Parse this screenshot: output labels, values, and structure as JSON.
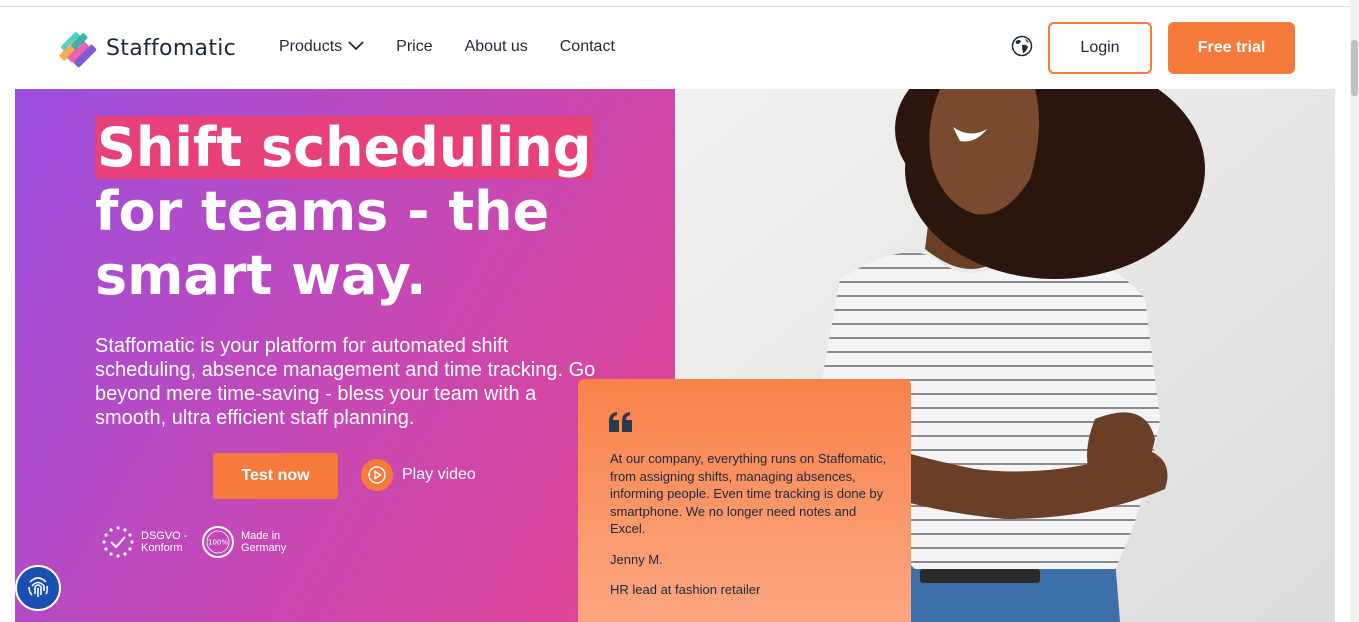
{
  "header": {
    "logo_text": "Staffomatic",
    "nav": [
      {
        "label": "Products",
        "has_dropdown": true
      },
      {
        "label": "Price"
      },
      {
        "label": "About us"
      },
      {
        "label": "Contact"
      }
    ],
    "login_label": "Login",
    "trial_label": "Free trial",
    "language_icon": "globe-icon"
  },
  "hero": {
    "headline_highlight": "Shift scheduling",
    "headline_line2": "for teams - the",
    "headline_line3": "smart way.",
    "subtitle": "Staffomatic is your platform for automated shift scheduling, absence management and time tracking. Go beyond mere time-saving - bless your team with a smooth, ultra efficient staff planning.",
    "cta_label": "Test now",
    "play_label": "Play video",
    "badges": [
      {
        "line1": "DSGVO -",
        "line2": "Konform",
        "icon": "eu-stars-check-icon"
      },
      {
        "line1": "Made in",
        "line2": "Germany",
        "icon_text": "100%"
      }
    ]
  },
  "testimonial": {
    "text": "At our company, everything runs on Staffomatic, from assigning shifts, managing absences, informing people. Even time tracking is done by smartphone. We no longer need notes and Excel.",
    "name": "Jenny M.",
    "role": "HR lead at fashion retailer"
  },
  "colors": {
    "accent": "#f67a3c",
    "highlight": "#e8407a",
    "gradient_start": "#9a4fe0",
    "gradient_end": "#e5458f",
    "text_dark": "#1e2a3a"
  }
}
